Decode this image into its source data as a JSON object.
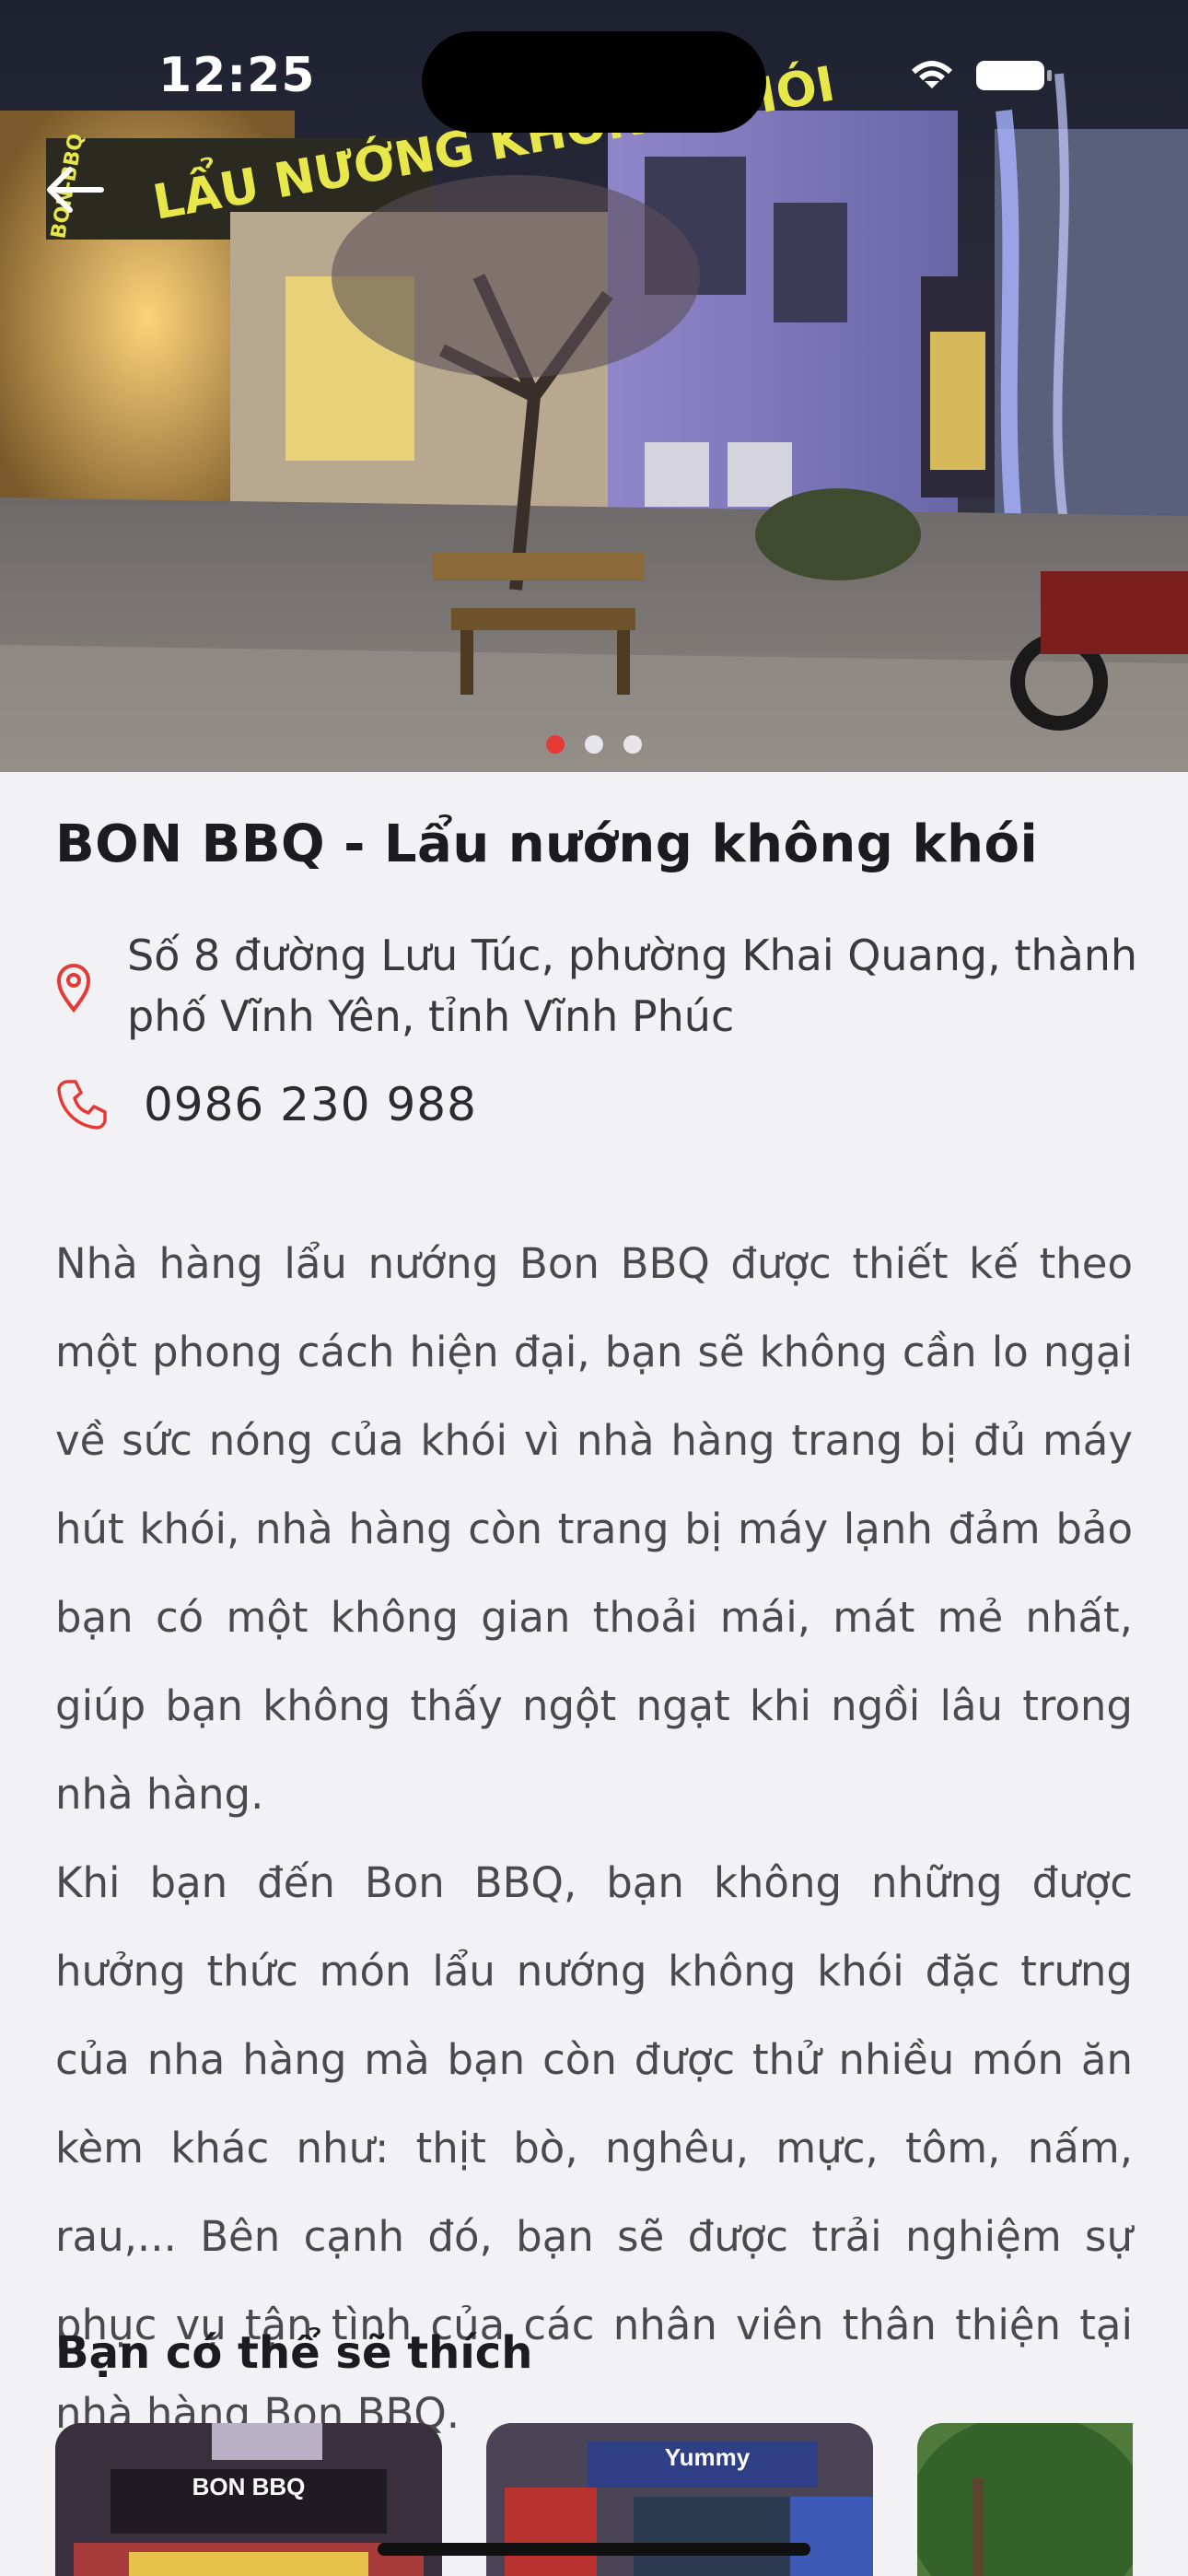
{
  "status_bar": {
    "time": "12:25"
  },
  "hero": {
    "sign_text": "LẨU NƯỚNG KHÔNG KHÓI",
    "sign_brand": "BON-BBQ",
    "carousel_pages": 3,
    "carousel_active_index": 0,
    "colors": {
      "active_dot": "#e53935",
      "inactive_dot": "#e6e6ea"
    }
  },
  "restaurant": {
    "name": "BON BBQ - Lẩu nướng không khói",
    "address": "Số 8 đường Lưu Túc, phường Khai Quang, thành phố Vĩnh Yên, tỉnh Vĩnh Phúc",
    "phone": "0986 230 988",
    "description_1": "Nhà hàng lẩu nướng Bon BBQ được thiết kế theo một phong cách hiện đại, bạn sẽ không cần lo ngại về sức nóng của khói vì nhà hàng trang bị đủ máy hút khói, nhà hàng còn trang bị máy lạnh đảm bảo bạn có một không gian thoải mái, mát mẻ nhất, giúp bạn không thấy ngột ngạt khi ngồi lâu trong nhà hàng.",
    "description_2": "Khi bạn đến Bon BBQ, bạn không những được hưởng thức món lẩu nướng không khói đặc trưng của nha hàng mà bạn còn được thử nhiều món ăn kèm khác như: thịt bò, nghêu, mực, tôm, nấm, rau,... Bên cạnh đó, bạn sẽ được trải nghiệm sự phục vụ tận tình của các nhân viên thân thiện tại nhà hàng Bon BBQ."
  },
  "suggestions": {
    "title": "Bạn có thể sẽ thích",
    "cards": [
      {
        "label": "BON BBQ",
        "color": "#3a2f3c"
      },
      {
        "label": "Yummy",
        "color": "#4b4456"
      },
      {
        "label": "",
        "color": "#3d6b34"
      }
    ]
  },
  "colors": {
    "accent": "#e53935",
    "background": "#f2f2f5"
  }
}
